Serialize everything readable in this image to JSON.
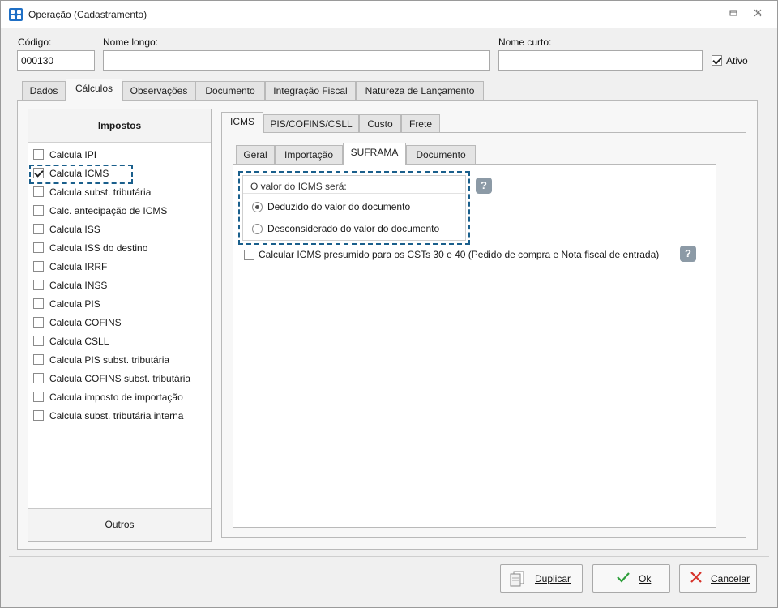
{
  "window": {
    "title": "Operação (Cadastramento)"
  },
  "fields": {
    "codigo_label": "Código:",
    "codigo_value": "000130",
    "nome_longo_label": "Nome longo:",
    "nome_longo_value": "",
    "nome_curto_label": "Nome curto:",
    "nome_curto_value": "",
    "ativo_label": "Ativo",
    "ativo_checked": true
  },
  "tabs": [
    "Dados",
    "Cálculos",
    "Observações",
    "Documento",
    "Integração Fiscal",
    "Natureza de Lançamento"
  ],
  "active_tab": "Cálculos",
  "impostos": {
    "header": "Impostos",
    "footer": "Outros",
    "items": [
      {
        "label": "Calcula IPI",
        "checked": false
      },
      {
        "label": "Calcula ICMS",
        "checked": true
      },
      {
        "label": "Calcula subst. tributária",
        "checked": false
      },
      {
        "label": "Calc. antecipação de ICMS",
        "checked": false
      },
      {
        "label": "Calcula ISS",
        "checked": false
      },
      {
        "label": "Calcula ISS do destino",
        "checked": false
      },
      {
        "label": "Calcula IRRF",
        "checked": false
      },
      {
        "label": "Calcula INSS",
        "checked": false
      },
      {
        "label": "Calcula PIS",
        "checked": false
      },
      {
        "label": "Calcula COFINS",
        "checked": false
      },
      {
        "label": "Calcula CSLL",
        "checked": false
      },
      {
        "label": "Calcula PIS subst. tributária",
        "checked": false
      },
      {
        "label": "Calcula COFINS subst. tributária",
        "checked": false
      },
      {
        "label": "Calcula imposto de importação",
        "checked": false
      },
      {
        "label": "Calcula subst. tributária interna",
        "checked": false
      }
    ]
  },
  "sub_tabs": [
    "ICMS",
    "PIS/COFINS/CSLL",
    "Custo",
    "Frete"
  ],
  "inner_tabs": [
    "Geral",
    "Importação",
    "SUFRAMA",
    "Documento"
  ],
  "suframa": {
    "group_title": "O valor do ICMS será:",
    "option_1": "Deduzido do valor do documento",
    "option_2": "Desconsiderado do valor do documento",
    "selected_option": 1,
    "presumido_label": "Calcular ICMS presumido para os CSTs 30 e 40 (Pedido de compra e Nota fiscal de entrada)",
    "presumido_checked": false,
    "help_glyph": "?"
  },
  "buttons": {
    "duplicar": "Duplicar",
    "ok": "Ok",
    "cancelar": "Cancelar"
  },
  "icons": {
    "app": "app-grid-icon",
    "restore": "restore-icon",
    "close": "close-icon",
    "duplicar": "duplicate-document-icon",
    "ok": "checkmark-icon",
    "cancel": "x-icon"
  },
  "colors": {
    "accent_dash": "#1a5f8c",
    "ok_green": "#2e9e3b",
    "cancel_red": "#d6332a",
    "app_blue": "#1f6fc5"
  }
}
